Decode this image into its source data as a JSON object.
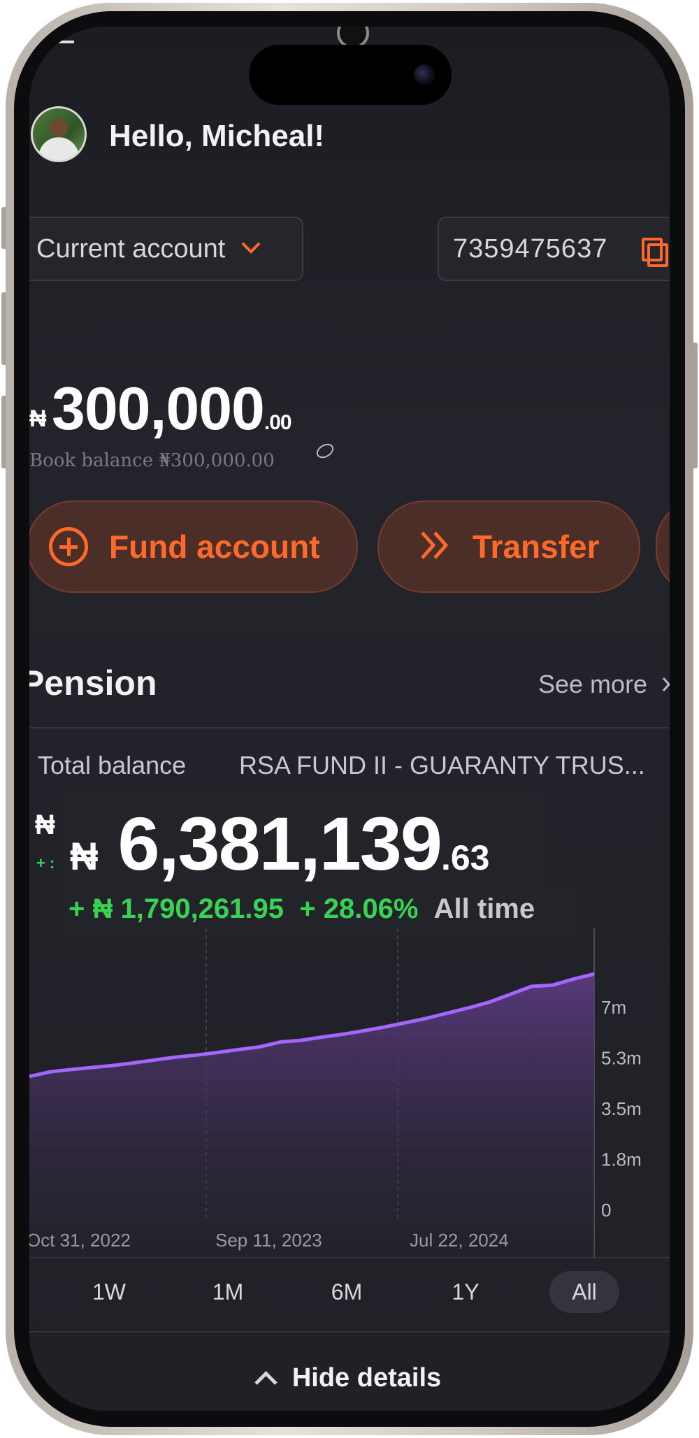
{
  "header": {
    "greeting": "Hello, Micheal!"
  },
  "account": {
    "selector_label": "Current account",
    "number": "7359475637"
  },
  "balance": {
    "currency": "₦",
    "amount": "300,000",
    "decimals": ".00",
    "book_balance": "Book balance ₦300,000.00"
  },
  "actions": {
    "fund_label": "Fund account",
    "transfer_label": "Transfer"
  },
  "pension": {
    "title": "Pension",
    "see_more": "See more",
    "tab_total": "Total balance",
    "tab_fund": "RSA FUND II - GUARANTY TRUS...",
    "ghost_currency": "₦",
    "ghost_gain": "+ :",
    "currency": "₦",
    "amount": "6,381,139",
    "decimals": ".63",
    "gain_amount": "+ ₦ 1,790,261.95",
    "gain_percent": "+ 28.06%",
    "gain_period": "All time"
  },
  "ranges": [
    "1W",
    "1M",
    "6M",
    "1Y",
    "All"
  ],
  "active_range": "All",
  "footer": {
    "hide_details": "Hide details"
  },
  "colors": {
    "accent": "#ff6a2a",
    "gain": "#39d353",
    "line": "#a566ff"
  },
  "icons": {
    "dropdown": "chevron-down-icon",
    "copy": "copy-icon",
    "visibility": "eye-off-icon",
    "fund": "plus-circle-icon",
    "transfer": "double-chevron-right-icon",
    "see_more": "chevron-right-icon",
    "hide": "chevron-up-icon"
  },
  "chart_data": {
    "type": "area",
    "x_tick_labels": [
      "Oct 31, 2022",
      "Sep 11, 2023",
      "Jul 22, 2024"
    ],
    "y_tick_labels": [
      "7m",
      "5.3m",
      "3.5m",
      "1.8m",
      "0"
    ],
    "ylim": [
      0,
      7000000
    ],
    "grid": "vertical dashed lines at x tick positions",
    "series": [
      {
        "values": [
          4590000,
          4750000,
          4830000,
          4900000,
          4970000,
          5060000,
          5160000,
          5260000,
          5330000,
          5420000,
          5520000,
          5610000,
          5780000,
          5840000,
          5950000,
          6050000,
          6170000,
          6300000,
          6450000,
          6600000,
          6780000,
          6960000,
          7160000,
          7430000,
          7700000,
          7740000,
          7950000,
          8130000
        ]
      }
    ]
  }
}
